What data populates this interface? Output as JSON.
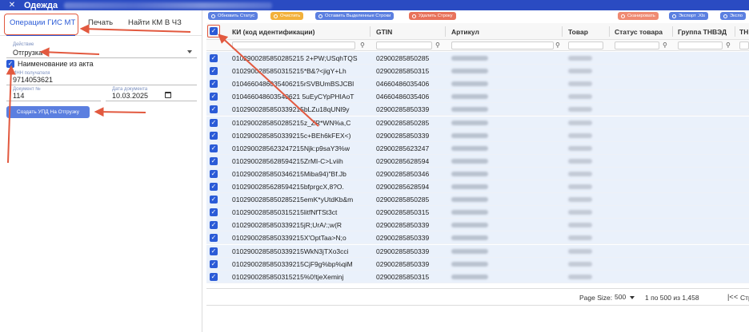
{
  "window": {
    "title": "Одежда",
    "close_icon": "close-icon"
  },
  "tabs": [
    {
      "label": "Операции ГИС МТ",
      "active": true
    },
    {
      "label": "Печать",
      "active": false
    },
    {
      "label": "Найти КМ В ЧЗ",
      "active": false
    }
  ],
  "form": {
    "action": {
      "label": "Действие",
      "value": "Отгрузка"
    },
    "use_act_name": {
      "label": "Наименование из акта",
      "checked": true
    },
    "inn": {
      "label": "ИНН получателя",
      "value": "9714053621"
    },
    "doc_number": {
      "label": "Документ №",
      "value": "114"
    },
    "doc_date": {
      "label": "Дата документа",
      "value": "10.03.2025"
    },
    "create_button": "Создать УПД На Отгрузку"
  },
  "toolbar": {
    "refresh_status": "Обновить Статус",
    "clear": "Очистить",
    "keep_selected": "Оставить Выделенные Строки",
    "delete_row": "Удалить Строку",
    "scan": "Сканировать",
    "export_xls": "Экспорт .Xls",
    "export_more": "Экспо"
  },
  "grid": {
    "columns": [
      "КИ (код идентификации)",
      "GTIN",
      "Артикул",
      "Товар",
      "Статус товара",
      "Группа ТНВЭД",
      "ТН"
    ],
    "rows": [
      {
        "ki": "0102900285850285215 2+PW;USqhTQS",
        "gtin": "02900285850285"
      },
      {
        "ki": "0102900285850315215*B&?<jigY+Lh",
        "gtin": "02900285850315"
      },
      {
        "ki": "0104660486035406215rSVBUmBSJCBl",
        "gtin": "04660486035406"
      },
      {
        "ki": "010466048603540621 5uEyCYpPHIAoT",
        "gtin": "04660486035406"
      },
      {
        "ki": "0102900285850339215bLZu18qUNl9y",
        "gtin": "02900285850339"
      },
      {
        "ki": "0102900285850285215z_ZR*WN%a,C",
        "gtin": "02900285850285"
      },
      {
        "ki": "0102900285850339215c+BEh6kFEX<)",
        "gtin": "02900285850339"
      },
      {
        "ki": "0102900285623247215Njk:p9saY3%w",
        "gtin": "02900285623247"
      },
      {
        "ki": "0102900285628594215ZrMI-C>Lviih",
        "gtin": "02900285628594"
      },
      {
        "ki": "0102900285850346215Miba94)\"Bf.Jb",
        "gtin": "02900285850346"
      },
      {
        "ki": "0102900285628594215bfprgcX,8?O.",
        "gtin": "02900285628594"
      },
      {
        "ki": "0102900285850285215emK*yUtdKb&m",
        "gtin": "02900285850285"
      },
      {
        "ki": "0102900285850315215litfNfTSt3ct",
        "gtin": "02900285850315"
      },
      {
        "ki": "0102900285850339215jR;UrA/:;w(R",
        "gtin": "02900285850339"
      },
      {
        "ki": "0102900285850339215X'OptTaa>N;o",
        "gtin": "02900285850339"
      },
      {
        "ki": "0102900285850339215WkN3jTXo3cci",
        "gtin": "02900285850339"
      },
      {
        "ki": "0102900285850339215CjF9g%bp%qiM",
        "gtin": "02900285850339"
      },
      {
        "ki": "0102900285850315215%0!tjeXeminj",
        "gtin": "02900285850315"
      }
    ]
  },
  "footer": {
    "page_size_label": "Page Size:",
    "page_size": "500",
    "range": "1 по 500 из 1,458",
    "prev_page_label": "Стра"
  },
  "colors": {
    "accent": "#2b5bd7",
    "annotation": "#e2593f",
    "titlebar": "#2a4bc2"
  }
}
